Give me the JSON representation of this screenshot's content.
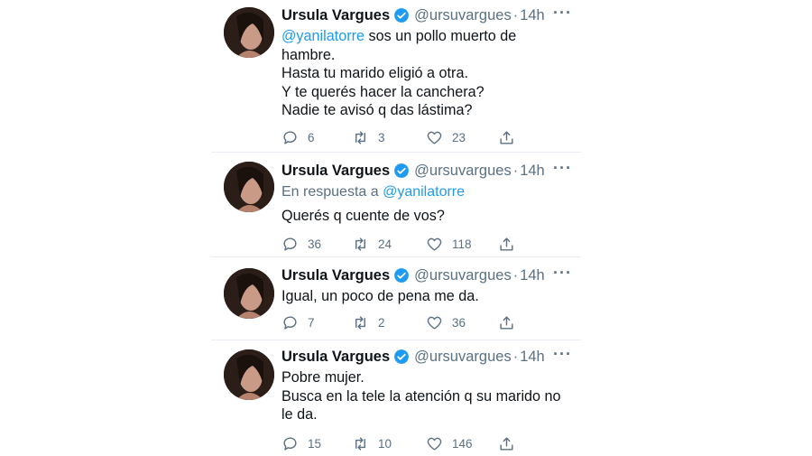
{
  "tweets": [
    {
      "name": "Ursula Vargues",
      "handle": "@ursuvargues",
      "dot": "·",
      "time": "14h",
      "more": "···",
      "mention": "@yanilatorre",
      "lines": [
        "sos un pollo muerto de",
        "hambre.",
        "Hasta tu marido eligió a otra.",
        "Y te querés hacer la canchera?",
        "Nadie te avisó q das lástima?"
      ],
      "replies": "6",
      "retweets": "3",
      "likes": "23"
    },
    {
      "name": "Ursula Vargues",
      "handle": "@ursuvargues",
      "dot": "·",
      "time": "14h",
      "more": "···",
      "replying_prefix": "En respuesta a",
      "replying_to": "@yanilatorre",
      "lines": [
        "Querés q cuente de vos?"
      ],
      "replies": "36",
      "retweets": "24",
      "likes": "118"
    },
    {
      "name": "Ursula Vargues",
      "handle": "@ursuvargues",
      "dot": "·",
      "time": "14h",
      "more": "···",
      "lines": [
        "Igual, un poco de pena me da."
      ],
      "replies": "7",
      "retweets": "2",
      "likes": "36"
    },
    {
      "name": "Ursula Vargues",
      "handle": "@ursuvargues",
      "dot": "·",
      "time": "14h",
      "more": "···",
      "lines": [
        "Pobre mujer.",
        "Busca en la tele la atención q su marido no",
        "le da."
      ],
      "replies": "15",
      "retweets": "10",
      "likes": "146"
    }
  ],
  "colors": {
    "text": "#0f1419",
    "secondary": "#5b7083",
    "link": "#1d9bf0",
    "verified": "#1d9bf0",
    "divider": "#e6ecf0"
  },
  "icons": [
    "verified-badge-icon",
    "reply-icon",
    "retweet-icon",
    "like-icon",
    "share-icon",
    "more-icon"
  ]
}
